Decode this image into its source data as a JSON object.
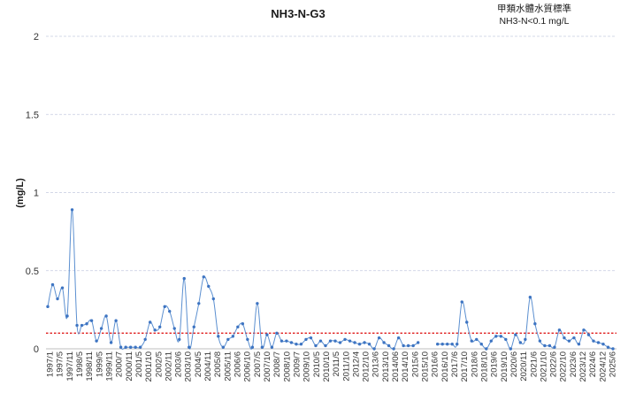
{
  "chart_data": {
    "type": "line",
    "title": "NH3-N-G3",
    "ylabel": "(mg/L)",
    "xlabel": "",
    "ylim": [
      0,
      2
    ],
    "yticks": [
      "0",
      "0.5",
      "1",
      "1.5",
      "2"
    ],
    "grid": true,
    "annotation": [
      "甲類水體水質標準",
      "NH3-N<0.1 mg/L"
    ],
    "standard": {
      "y": 0.1,
      "color": "#e02020",
      "style": "dotted"
    },
    "series_color": "#4472c4",
    "x_tick_labels": [
      "1997/1",
      "1997/5",
      "1997/11",
      "1998/5",
      "1998/11",
      "1999/5",
      "1999/11",
      "2000/7",
      "2000/11",
      "2001/5",
      "2001/10",
      "2002/5",
      "2002/11",
      "2003/6",
      "2003/10",
      "2004/5",
      "2004/11",
      "2005/8",
      "2005/11",
      "2006/6",
      "2006/10",
      "2007/5",
      "2007/10",
      "2008/7",
      "2008/10",
      "2009/7",
      "2009/10",
      "2010/5",
      "2010/10",
      "2011/5",
      "2011/10",
      "2012/4",
      "2012/10",
      "2013/6",
      "2013/10",
      "2014/06",
      "2014/10",
      "2015/6",
      "2015/10",
      "2016/6",
      "2016/10",
      "2017/6",
      "2017/10",
      "2018/6",
      "2018/10",
      "2019/6",
      "2019/10",
      "2020/6",
      "2020/11",
      "2021/6",
      "2021/10",
      "2022/6",
      "2022/10",
      "2023/6",
      "2023/12",
      "2024/6",
      "2024/12",
      "2025/6"
    ],
    "segments": [
      [
        0.27,
        0.41,
        0.32,
        0.39,
        0.21,
        0.89,
        0.15,
        0.15,
        0.16,
        0.18,
        0.05,
        0.13,
        0.21,
        0.04,
        0.18,
        0.01,
        0.01,
        0.01,
        0.01,
        0.01,
        0.06,
        0.17,
        0.12,
        0.14,
        0.27,
        0.24,
        0.13,
        0.06,
        0.45,
        0.01,
        0.14,
        0.29,
        0.46,
        0.4,
        0.32,
        0.08,
        0.01,
        0.06,
        0.08,
        0.14,
        0.16,
        0.06,
        0.01,
        0.29,
        0.01,
        0.09,
        0.01,
        0.1,
        0.05,
        0.05,
        0.04,
        0.03,
        0.03,
        0.06,
        0.07,
        0.02,
        0.05,
        0.02,
        0.05,
        0.05,
        0.04,
        0.06,
        0.05,
        0.04,
        0.03,
        0.04,
        0.03,
        0.0,
        0.07,
        0.04,
        0.02,
        0.0,
        0.07,
        0.02,
        0.02,
        0.02,
        0.04
      ],
      [
        0.03,
        0.03,
        0.03,
        0.03,
        0.03,
        0.3,
        0.17,
        0.05,
        0.06,
        0.03,
        0.0,
        0.05,
        0.08,
        0.08,
        0.06,
        0.0,
        0.09,
        0.04,
        0.06,
        0.33,
        0.16,
        0.05,
        0.02,
        0.02,
        0.01,
        0.12,
        0.07,
        0.05,
        0.07,
        0.03,
        0.12,
        0.09,
        0.05,
        0.04,
        0.03,
        0.01,
        0.0
      ]
    ]
  }
}
